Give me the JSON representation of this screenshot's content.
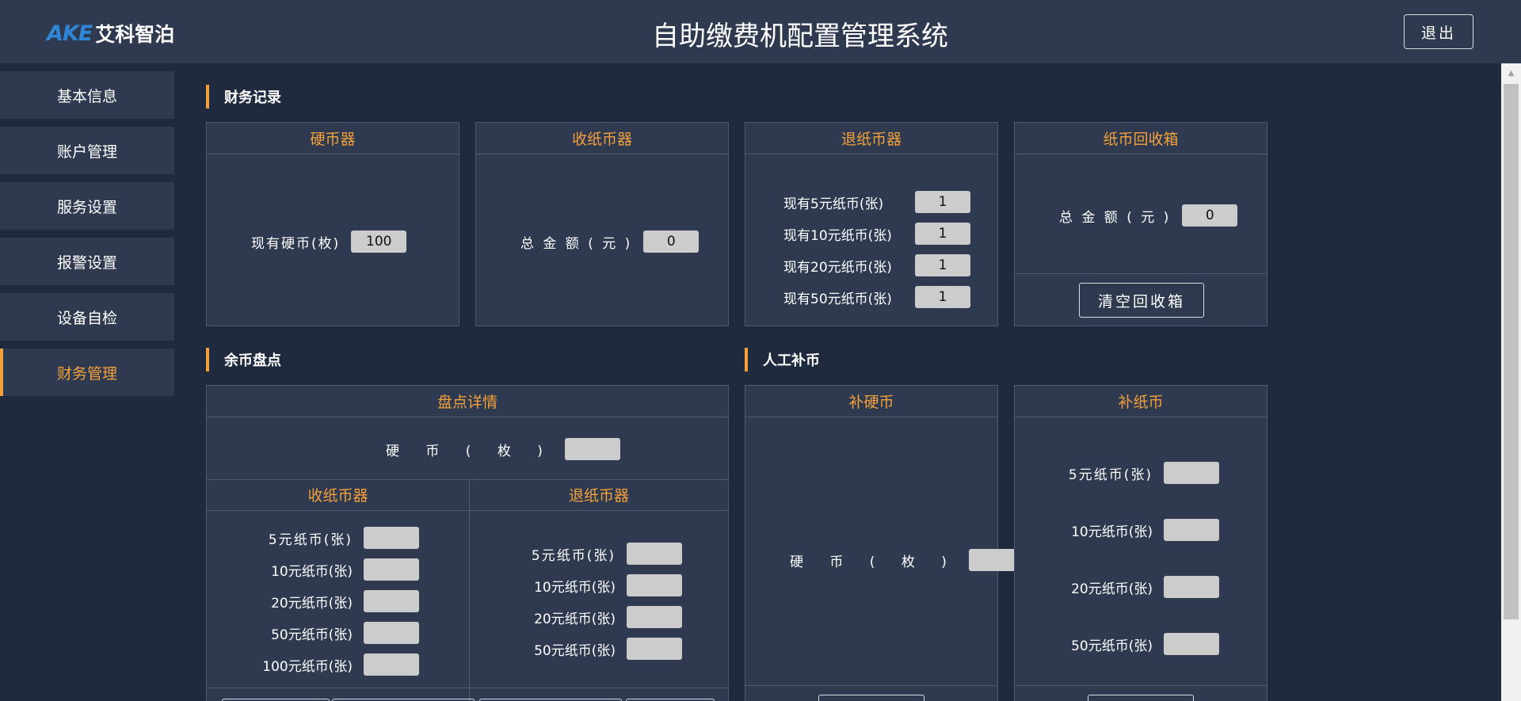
{
  "header": {
    "logo_en": "AKE",
    "logo_cn": "艾科智泊",
    "title": "自助缴费机配置管理系统",
    "logout_label": "退出"
  },
  "sidebar": {
    "items": [
      {
        "label": "基本信息"
      },
      {
        "label": "账户管理"
      },
      {
        "label": "服务设置"
      },
      {
        "label": "报警设置"
      },
      {
        "label": "设备自检"
      },
      {
        "label": "财务管理"
      }
    ],
    "active_index": 5
  },
  "finance_records": {
    "title": "财务记录",
    "coin_box": {
      "title": "硬币器",
      "label": "现有硬币(枚)",
      "value": "100"
    },
    "bill_acceptor": {
      "title": "收纸币器",
      "label": "总 金 额 ( 元 )",
      "value": "0"
    },
    "bill_dispenser": {
      "title": "退纸币器",
      "rows": [
        {
          "label": "现有5元纸币(张)",
          "value": "1"
        },
        {
          "label": "现有10元纸币(张)",
          "value": "1"
        },
        {
          "label": "现有20元纸币(张)",
          "value": "1"
        },
        {
          "label": "现有50元纸币(张)",
          "value": "1"
        }
      ]
    },
    "recycle_box": {
      "title": "纸币回收箱",
      "label": "总 金 额 ( 元 )",
      "value": "0",
      "clear_label": "清空回收箱"
    }
  },
  "balance_check": {
    "title": "余币盘点",
    "detail_title": "盘点详情",
    "coin_label": "硬 币 ( 枚 )",
    "coin_value": "",
    "acceptor": {
      "title": "收纸币器",
      "rows": [
        {
          "label": "5元纸币(张)",
          "value": ""
        },
        {
          "label": "10元纸币(张)",
          "value": ""
        },
        {
          "label": "20元纸币(张)",
          "value": ""
        },
        {
          "label": "50元纸币(张)",
          "value": ""
        },
        {
          "label": "100元纸币(张)",
          "value": ""
        }
      ]
    },
    "dispenser": {
      "title": "退纸币器",
      "rows": [
        {
          "label": "5元纸币(张)",
          "value": ""
        },
        {
          "label": "10元纸币(张)",
          "value": ""
        },
        {
          "label": "20元纸币(张)",
          "value": ""
        },
        {
          "label": "50元纸币(张)",
          "value": ""
        }
      ]
    }
  },
  "manual_refill": {
    "title": "人工补币",
    "coin": {
      "title": "补硬币",
      "label": "硬 币 ( 枚 )",
      "value": ""
    },
    "bills": {
      "title": "补纸币",
      "rows": [
        {
          "label": "5元纸币(张)",
          "value": ""
        },
        {
          "label": "10元纸币(张)",
          "value": ""
        },
        {
          "label": "20元纸币(张)",
          "value": ""
        },
        {
          "label": "50元纸币(张)",
          "value": ""
        }
      ]
    }
  },
  "colors": {
    "background": "#1f2a3f",
    "panel": "#2f3a50",
    "accent": "#f2a03a",
    "logo_blue": "#2e86d6"
  }
}
